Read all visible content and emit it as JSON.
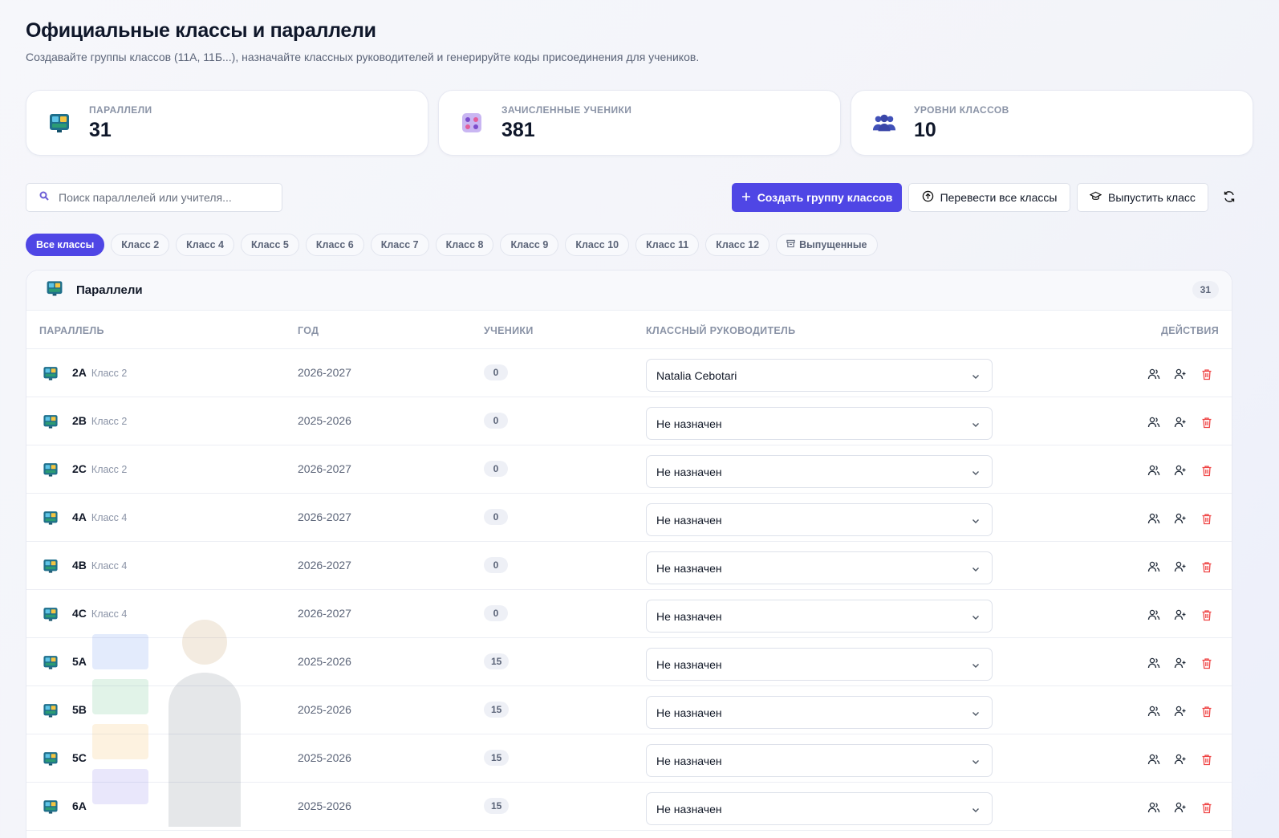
{
  "header": {
    "title": "Официальные классы и параллели",
    "subtitle": "Создавайте группы классов (11A, 11Б...), назначайте классных руководителей и генерируйте коды присоединения для учеников."
  },
  "stats": [
    {
      "label": "ПАРАЛЛЕЛИ",
      "value": "31",
      "icon": "classroom-icon"
    },
    {
      "label": "ЗАЧИСЛЕННЫЕ УЧЕНИКИ",
      "value": "381",
      "icon": "students-icon"
    },
    {
      "label": "УРОВНИ КЛАССОВ",
      "value": "10",
      "icon": "users-group-icon"
    }
  ],
  "toolbar": {
    "search_placeholder": "Поиск параллелей или учителя...",
    "create_label": "Создать группу классов",
    "promote_label": "Перевести все классы",
    "graduate_label": "Выпустить класс"
  },
  "filters": [
    "Все классы",
    "Класс 2",
    "Класс 4",
    "Класс 5",
    "Класс 6",
    "Класс 7",
    "Класс 8",
    "Класс 9",
    "Класс 10",
    "Класс 11",
    "Класс 12",
    "Выпущенные"
  ],
  "table": {
    "title": "Параллели",
    "count": "31",
    "columns": {
      "parallel": "ПАРАЛЛЕЛЬ",
      "year": "ГОД",
      "students": "УЧЕНИКИ",
      "teacher": "КЛАССНЫЙ РУКОВОДИТЕЛЬ",
      "actions": "ДЕЙСТВИЯ"
    },
    "rows": [
      {
        "name": "2A",
        "grade": "Класс 2",
        "year": "2026-2027",
        "students": "0",
        "teacher": "Natalia Cebotari"
      },
      {
        "name": "2B",
        "grade": "Класс 2",
        "year": "2025-2026",
        "students": "0",
        "teacher": "Не назначен"
      },
      {
        "name": "2C",
        "grade": "Класс 2",
        "year": "2026-2027",
        "students": "0",
        "teacher": "Не назначен"
      },
      {
        "name": "4A",
        "grade": "Класс 4",
        "year": "2026-2027",
        "students": "0",
        "teacher": "Не назначен"
      },
      {
        "name": "4B",
        "grade": "Класс 4",
        "year": "2026-2027",
        "students": "0",
        "teacher": "Не назначен"
      },
      {
        "name": "4C",
        "grade": "Класс 4",
        "year": "2026-2027",
        "students": "0",
        "teacher": "Не назначен"
      },
      {
        "name": "5A",
        "grade": "",
        "year": "2025-2026",
        "students": "15",
        "teacher": "Не назначен"
      },
      {
        "name": "5B",
        "grade": "",
        "year": "2025-2026",
        "students": "15",
        "teacher": "Не назначен"
      },
      {
        "name": "5C",
        "grade": "",
        "year": "2025-2026",
        "students": "15",
        "teacher": "Не назначен"
      },
      {
        "name": "6A",
        "grade": "",
        "year": "2025-2026",
        "students": "15",
        "teacher": "Не назначен"
      }
    ]
  },
  "colors": {
    "accent": "#4f46e5",
    "danger": "#ef4444"
  }
}
